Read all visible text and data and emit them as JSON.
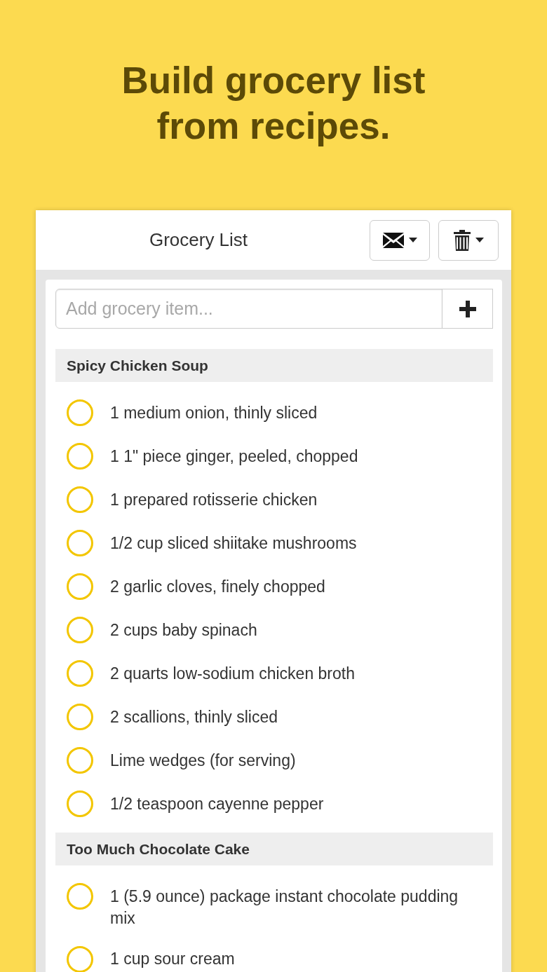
{
  "headline": "Build grocery list from recipes.",
  "header": {
    "title": "Grocery List"
  },
  "add_field": {
    "placeholder": "Add grocery item..."
  },
  "sections": [
    {
      "title": "Spicy Chicken Soup",
      "items": [
        {
          "text": "1 medium onion, thinly sliced",
          "checked": false
        },
        {
          "text": "1 1\" piece ginger, peeled, chopped",
          "checked": false
        },
        {
          "text": "1 prepared rotisserie chicken",
          "checked": false
        },
        {
          "text": "1/2 cup sliced shiitake mushrooms",
          "checked": false
        },
        {
          "text": "2 garlic cloves, finely chopped",
          "checked": false
        },
        {
          "text": "2 cups baby spinach",
          "checked": false
        },
        {
          "text": "2 quarts low-sodium chicken broth",
          "checked": false
        },
        {
          "text": "2 scallions, thinly sliced",
          "checked": false
        },
        {
          "text": "Lime wedges (for serving)",
          "checked": false
        },
        {
          "text": "1/2 teaspoon cayenne pepper",
          "checked": false
        }
      ]
    },
    {
      "title": "Too Much Chocolate Cake",
      "items": [
        {
          "text": "1 (5.9 ounce) package instant chocolate pudding mix",
          "checked": false
        },
        {
          "text": "1 cup sour cream",
          "checked": false
        }
      ]
    }
  ]
}
